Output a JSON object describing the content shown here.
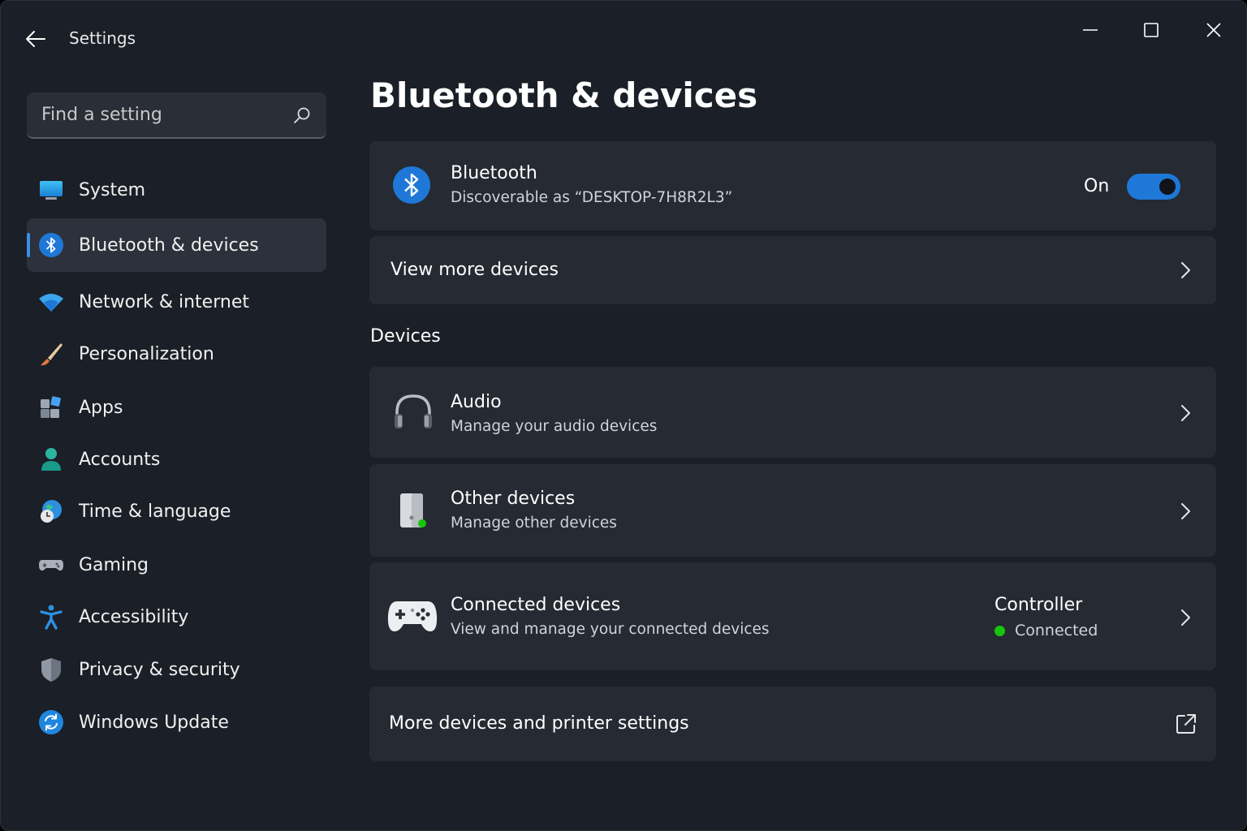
{
  "window": {
    "title": "Settings"
  },
  "search": {
    "placeholder": "Find a setting"
  },
  "sidebar": {
    "items": [
      {
        "label": "System",
        "icon": "monitor-icon"
      },
      {
        "label": "Bluetooth & devices",
        "icon": "bluetooth-icon",
        "active": true
      },
      {
        "label": "Network & internet",
        "icon": "wifi-icon"
      },
      {
        "label": "Personalization",
        "icon": "brush-icon"
      },
      {
        "label": "Apps",
        "icon": "apps-icon"
      },
      {
        "label": "Accounts",
        "icon": "person-icon"
      },
      {
        "label": "Time & language",
        "icon": "globe-clock-icon"
      },
      {
        "label": "Gaming",
        "icon": "gamepad-icon"
      },
      {
        "label": "Accessibility",
        "icon": "accessibility-icon"
      },
      {
        "label": "Privacy & security",
        "icon": "shield-icon"
      },
      {
        "label": "Windows Update",
        "icon": "update-icon"
      }
    ]
  },
  "main": {
    "title": "Bluetooth & devices",
    "bluetooth": {
      "title": "Bluetooth",
      "subtitle": "Discoverable as “DESKTOP-7H8R2L3”",
      "toggle_label": "On",
      "toggle_on": true
    },
    "view_more": {
      "label": "View more devices"
    },
    "devices_section": "Devices",
    "devices": [
      {
        "title": "Audio",
        "subtitle": "Manage your audio devices",
        "icon": "headphones-icon"
      },
      {
        "title": "Other devices",
        "subtitle": "Manage other devices",
        "icon": "device-icon"
      },
      {
        "title": "Connected devices",
        "subtitle": "View and manage your connected devices",
        "icon": "controller-icon",
        "status_title": "Controller",
        "status_text": "Connected"
      }
    ],
    "more_settings": {
      "label": "More devices and printer settings",
      "icon": "external-link-icon"
    }
  },
  "colors": {
    "accent": "#1f78d8",
    "background": "#1b1f27",
    "card": "#262a33",
    "connected": "#16c60c"
  }
}
